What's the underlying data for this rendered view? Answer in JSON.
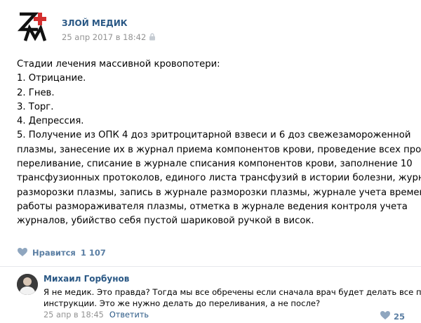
{
  "post": {
    "group_name": "ЗЛОЙ МЕДИК",
    "date": "25 апр 2017 в 18:42",
    "lines": [
      "Стадии лечения массивной кровопотери:",
      "1. Отрицание.",
      "2. Гнев.",
      "3. Торг.",
      "4. Депрессия.",
      "5. Получение из ОПК 4 доз эритроцитарной взвеси и 6 доз свежезамороженной",
      "плазмы, занесение их в журнал приема компонентов крови, проведение всех проб,",
      "переливание, списание в журнале списания компонентов крови, заполнение 10",
      "трансфузионных протоколов, единого листа трансфузий в истории болезни, журнала",
      "разморозки плазмы, запись в журнале разморозки плазмы, журнале учета времени",
      "работы размораживателя плазмы, отметка в журнале ведения контроля учета",
      "журналов, убийство себя пустой шариковой ручкой в висок."
    ],
    "like_label": "Нравится",
    "like_count": "1 107"
  },
  "comment": {
    "author": "Михаил Горбунов",
    "lines": [
      "Я не медик. Это правда? Тогда мы все обречены если сначала врач будет делать все по",
      "инструкции. Это же нужно делать до переливания, а не после?"
    ],
    "date": "25 апр в 18:45",
    "reply_label": "Ответить",
    "like_count": "25"
  },
  "icons": {
    "logo": "zm-logo-icon",
    "lock": "lock-icon",
    "like": "heart-icon",
    "comment_like": "heart-icon"
  },
  "colors": {
    "link": "#2a5885",
    "muted": "#939393",
    "like": "#5a7ea3",
    "logo_red": "#d32f2f"
  }
}
